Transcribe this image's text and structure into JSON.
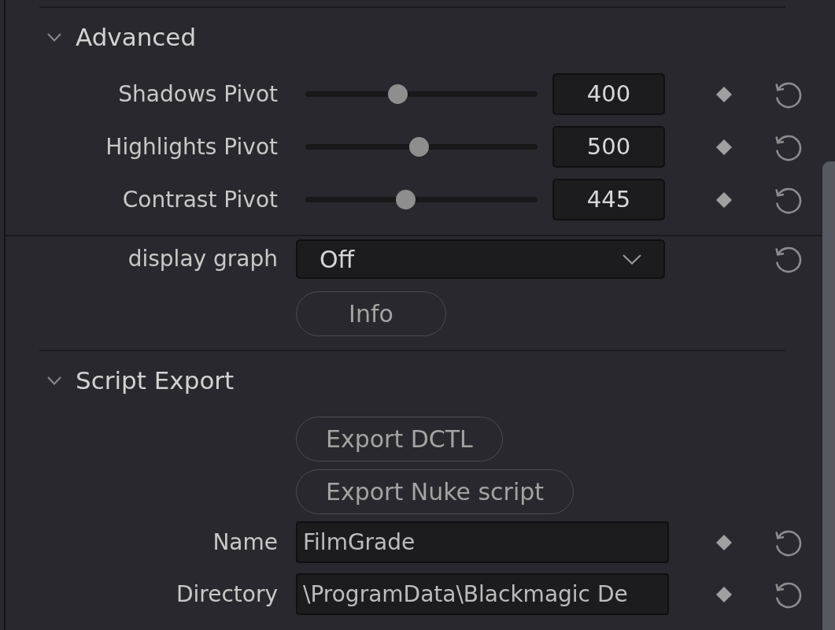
{
  "sections": [
    {
      "kind": "section",
      "title": "Advanced",
      "expanded": true,
      "rows": [
        {
          "kind": "slider",
          "label": "Shadows Pivot",
          "level": 0.39,
          "value": "400"
        },
        {
          "kind": "slider",
          "label": "Highlights Pivot",
          "level": 0.49,
          "value": "500"
        },
        {
          "kind": "slider",
          "label": "Contrast Pivot",
          "level": 0.425,
          "value": "445"
        }
      ]
    },
    {
      "kind": "group",
      "rows": [
        {
          "kind": "dropdown",
          "label": "display graph",
          "value": "Off"
        },
        {
          "kind": "button",
          "label": "Info"
        }
      ]
    },
    {
      "kind": "section",
      "title": "Script Export",
      "expanded": true,
      "rows": [
        {
          "kind": "button",
          "label": "Export DCTL"
        },
        {
          "kind": "button",
          "label": "Export Nuke script"
        },
        {
          "kind": "text",
          "label": "Name",
          "value": "FilmGrade"
        },
        {
          "kind": "text",
          "label": "Directory",
          "value": "\\ProgramData\\Blackmagic De"
        }
      ]
    }
  ]
}
